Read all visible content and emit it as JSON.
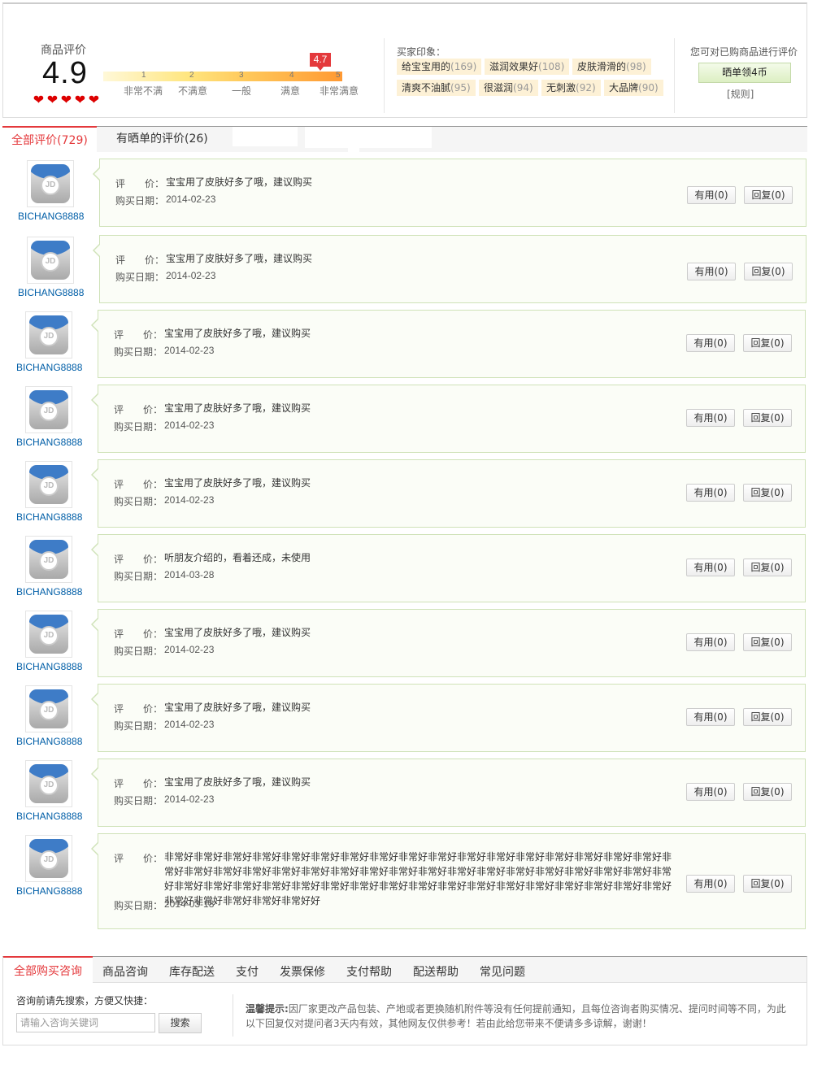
{
  "rating": {
    "label": "商品评价",
    "score": "4.9",
    "hearts": [
      "❤",
      "❤",
      "❤",
      "❤",
      "❤"
    ],
    "pointer_value": "4.7",
    "scale_numbers": [
      "1",
      "2",
      "3",
      "4",
      "5"
    ],
    "scale_words": [
      "非常不满",
      "不满意",
      "一般",
      "满意",
      "非常满意"
    ]
  },
  "impressions": {
    "label": "买家印象：",
    "tags": [
      {
        "text": "给宝宝用的",
        "count": "(169)"
      },
      {
        "text": "滋润效果好",
        "count": "(108)"
      },
      {
        "text": "皮肤滑滑的",
        "count": "(98)"
      },
      {
        "text": "清爽不油腻",
        "count": "(95)"
      },
      {
        "text": "很滋润",
        "count": "(94)"
      },
      {
        "text": "无刺激",
        "count": "(92)"
      },
      {
        "text": "大品牌",
        "count": "(90)"
      }
    ]
  },
  "review_cta": {
    "prompt": "您可对已购商品进行评价",
    "button": "晒单领4币",
    "rules": "[规则]"
  },
  "tabs": {
    "all": "全部评价(729)",
    "with_photos": "有晒单的评价(26)"
  },
  "comment_labels": {
    "review": "评　　价：",
    "date": "购买日期："
  },
  "comments": [
    {
      "user": "BICHANG8888",
      "text": "宝宝用了皮肤好多了哦，建议购买",
      "date": "2014-02-23",
      "useful": "有用(0)",
      "reply": "回复(0)"
    },
    {
      "user": "BICHANG8888",
      "text": "宝宝用了皮肤好多了哦，建议购买",
      "date": "2014-02-23",
      "useful": "有用(0)",
      "reply": "回复(0)"
    },
    {
      "user": "BICHANG8888",
      "text": "宝宝用了皮肤好多了哦，建议购买",
      "date": "2014-02-23",
      "useful": "有用(0)",
      "reply": "回复(0)"
    },
    {
      "user": "BICHANG8888",
      "text": "宝宝用了皮肤好多了哦，建议购买",
      "date": "2014-02-23",
      "useful": "有用(0)",
      "reply": "回复(0)"
    },
    {
      "user": "BICHANG8888",
      "text": "宝宝用了皮肤好多了哦，建议购买",
      "date": "2014-02-23",
      "useful": "有用(0)",
      "reply": "回复(0)"
    },
    {
      "user": "BICHANG8888",
      "text": "听朋友介绍的，看着还成，未使用",
      "date": "2014-03-28",
      "useful": "有用(0)",
      "reply": "回复(0)"
    },
    {
      "user": "BICHANG8888",
      "text": "宝宝用了皮肤好多了哦，建议购买",
      "date": "2014-02-23",
      "useful": "有用(0)",
      "reply": "回复(0)"
    },
    {
      "user": "BICHANG8888",
      "text": "宝宝用了皮肤好多了哦，建议购买",
      "date": "2014-02-23",
      "useful": "有用(0)",
      "reply": "回复(0)"
    },
    {
      "user": "BICHANG8888",
      "text": "宝宝用了皮肤好多了哦，建议购买",
      "date": "2014-02-23",
      "useful": "有用(0)",
      "reply": "回复(0)"
    },
    {
      "user": "BICHANG8888",
      "text": "非常好非常好非常好非常好非常好非常好非常好非常好非常好非常好非常好非常好非常好非常好非常好非常好非常好非常好非常好非常好非常好非常好非常好非常好非常好非常好非常好非常好非常好非常好非常好非常好非常好非常好非常好非常好非常好非常好非常好非常好非常好非常好非常好非常好非常好非常好非常好非常好非常好非常好非常好非常好非常好非常好非常好非常好非常好好",
      "date": "2014-03-18",
      "useful": "有用(0)",
      "reply": "回复(0)"
    }
  ],
  "consult": {
    "tabs": [
      "全部购买咨询",
      "商品咨询",
      "库存配送",
      "支付",
      "发票保修",
      "支付帮助",
      "配送帮助",
      "常见问题"
    ],
    "search_hint": "咨询前请先搜索，方便又快捷：",
    "search_placeholder": "请输入咨询关键词",
    "search_button": "搜索",
    "tip_title": "温馨提示:",
    "tip_text": "因厂家更改产品包装、产地或者更换随机附件等没有任何提前通知，且每位咨询者购买情况、提问时间等不同，为此以下回复仅对提问者3天内有效，其他网友仅供参考！若由此给您带来不便请多多谅解，谢谢！"
  },
  "colors": {
    "accent_red": "#e4393c",
    "link_blue": "#005ea7",
    "comment_border": "#cfe2b8"
  }
}
